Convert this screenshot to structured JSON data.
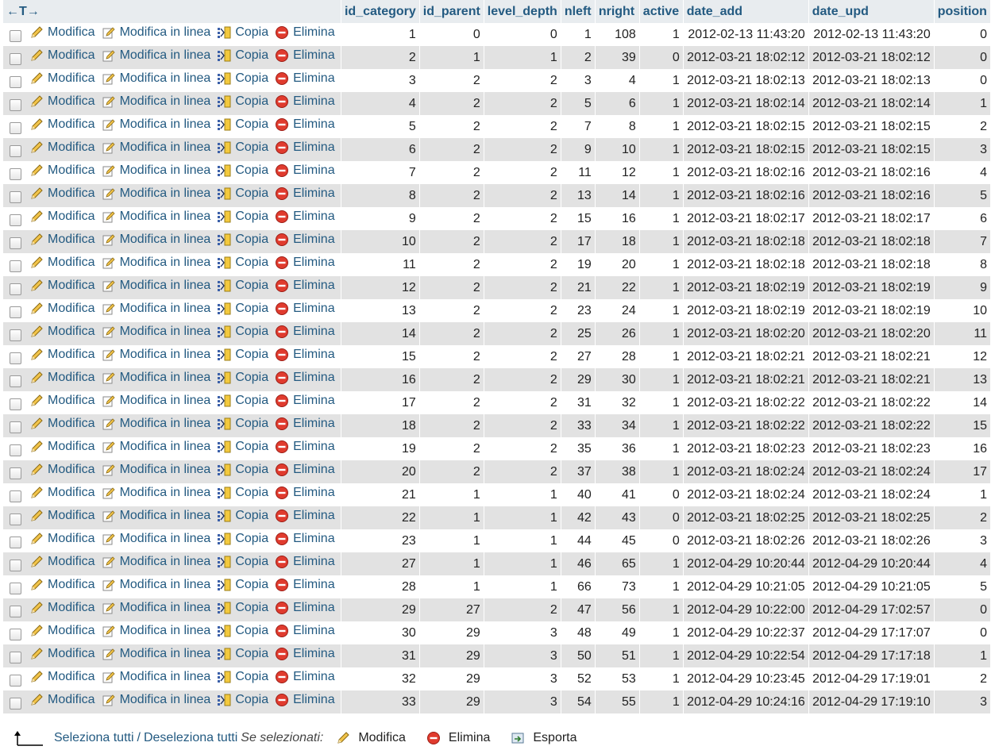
{
  "header": {
    "arrows": "←T→",
    "columns": [
      "id_category",
      "id_parent",
      "level_depth",
      "nleft",
      "nright",
      "active",
      "date_add",
      "date_upd",
      "position"
    ]
  },
  "actions": {
    "edit": "Modifica",
    "inline_edit": "Modifica in linea",
    "copy": "Copia",
    "delete": "Elimina"
  },
  "rows": [
    [
      "1",
      "0",
      "0",
      "1",
      "108",
      "1",
      "2012-02-13 11:43:20",
      "2012-02-13 11:43:20",
      "0"
    ],
    [
      "2",
      "1",
      "1",
      "2",
      "39",
      "0",
      "2012-03-21 18:02:12",
      "2012-03-21 18:02:12",
      "0"
    ],
    [
      "3",
      "2",
      "2",
      "3",
      "4",
      "1",
      "2012-03-21 18:02:13",
      "2012-03-21 18:02:13",
      "0"
    ],
    [
      "4",
      "2",
      "2",
      "5",
      "6",
      "1",
      "2012-03-21 18:02:14",
      "2012-03-21 18:02:14",
      "1"
    ],
    [
      "5",
      "2",
      "2",
      "7",
      "8",
      "1",
      "2012-03-21 18:02:15",
      "2012-03-21 18:02:15",
      "2"
    ],
    [
      "6",
      "2",
      "2",
      "9",
      "10",
      "1",
      "2012-03-21 18:02:15",
      "2012-03-21 18:02:15",
      "3"
    ],
    [
      "7",
      "2",
      "2",
      "11",
      "12",
      "1",
      "2012-03-21 18:02:16",
      "2012-03-21 18:02:16",
      "4"
    ],
    [
      "8",
      "2",
      "2",
      "13",
      "14",
      "1",
      "2012-03-21 18:02:16",
      "2012-03-21 18:02:16",
      "5"
    ],
    [
      "9",
      "2",
      "2",
      "15",
      "16",
      "1",
      "2012-03-21 18:02:17",
      "2012-03-21 18:02:17",
      "6"
    ],
    [
      "10",
      "2",
      "2",
      "17",
      "18",
      "1",
      "2012-03-21 18:02:18",
      "2012-03-21 18:02:18",
      "7"
    ],
    [
      "11",
      "2",
      "2",
      "19",
      "20",
      "1",
      "2012-03-21 18:02:18",
      "2012-03-21 18:02:18",
      "8"
    ],
    [
      "12",
      "2",
      "2",
      "21",
      "22",
      "1",
      "2012-03-21 18:02:19",
      "2012-03-21 18:02:19",
      "9"
    ],
    [
      "13",
      "2",
      "2",
      "23",
      "24",
      "1",
      "2012-03-21 18:02:19",
      "2012-03-21 18:02:19",
      "10"
    ],
    [
      "14",
      "2",
      "2",
      "25",
      "26",
      "1",
      "2012-03-21 18:02:20",
      "2012-03-21 18:02:20",
      "11"
    ],
    [
      "15",
      "2",
      "2",
      "27",
      "28",
      "1",
      "2012-03-21 18:02:21",
      "2012-03-21 18:02:21",
      "12"
    ],
    [
      "16",
      "2",
      "2",
      "29",
      "30",
      "1",
      "2012-03-21 18:02:21",
      "2012-03-21 18:02:21",
      "13"
    ],
    [
      "17",
      "2",
      "2",
      "31",
      "32",
      "1",
      "2012-03-21 18:02:22",
      "2012-03-21 18:02:22",
      "14"
    ],
    [
      "18",
      "2",
      "2",
      "33",
      "34",
      "1",
      "2012-03-21 18:02:22",
      "2012-03-21 18:02:22",
      "15"
    ],
    [
      "19",
      "2",
      "2",
      "35",
      "36",
      "1",
      "2012-03-21 18:02:23",
      "2012-03-21 18:02:23",
      "16"
    ],
    [
      "20",
      "2",
      "2",
      "37",
      "38",
      "1",
      "2012-03-21 18:02:24",
      "2012-03-21 18:02:24",
      "17"
    ],
    [
      "21",
      "1",
      "1",
      "40",
      "41",
      "0",
      "2012-03-21 18:02:24",
      "2012-03-21 18:02:24",
      "1"
    ],
    [
      "22",
      "1",
      "1",
      "42",
      "43",
      "0",
      "2012-03-21 18:02:25",
      "2012-03-21 18:02:25",
      "2"
    ],
    [
      "23",
      "1",
      "1",
      "44",
      "45",
      "0",
      "2012-03-21 18:02:26",
      "2012-03-21 18:02:26",
      "3"
    ],
    [
      "27",
      "1",
      "1",
      "46",
      "65",
      "1",
      "2012-04-29 10:20:44",
      "2012-04-29 10:20:44",
      "4"
    ],
    [
      "28",
      "1",
      "1",
      "66",
      "73",
      "1",
      "2012-04-29 10:21:05",
      "2012-04-29 10:21:05",
      "5"
    ],
    [
      "29",
      "27",
      "2",
      "47",
      "56",
      "1",
      "2012-04-29 10:22:00",
      "2012-04-29 17:02:57",
      "0"
    ],
    [
      "30",
      "29",
      "3",
      "48",
      "49",
      "1",
      "2012-04-29 10:22:37",
      "2012-04-29 17:17:07",
      "0"
    ],
    [
      "31",
      "29",
      "3",
      "50",
      "51",
      "1",
      "2012-04-29 10:22:54",
      "2012-04-29 17:17:18",
      "1"
    ],
    [
      "32",
      "29",
      "3",
      "52",
      "53",
      "1",
      "2012-04-29 10:23:45",
      "2012-04-29 17:19:01",
      "2"
    ],
    [
      "33",
      "29",
      "3",
      "54",
      "55",
      "1",
      "2012-04-29 10:24:16",
      "2012-04-29 17:19:10",
      "3"
    ]
  ],
  "footer": {
    "select_all": "Seleziona tutti",
    "separator": "/",
    "deselect_all": "Deseleziona tutti",
    "with_selected": "Se selezionati:",
    "edit": "Modifica",
    "delete": "Elimina",
    "export": "Esporta"
  },
  "colors": {
    "link": "#235a81",
    "row_even": "#e2e2e2",
    "header_bg": "#e8ecef"
  },
  "icons": {
    "edit": "pencil-icon",
    "inline_edit": "pencil-note-icon",
    "copy": "copy-icon",
    "delete": "delete-icon",
    "export": "export-icon"
  }
}
